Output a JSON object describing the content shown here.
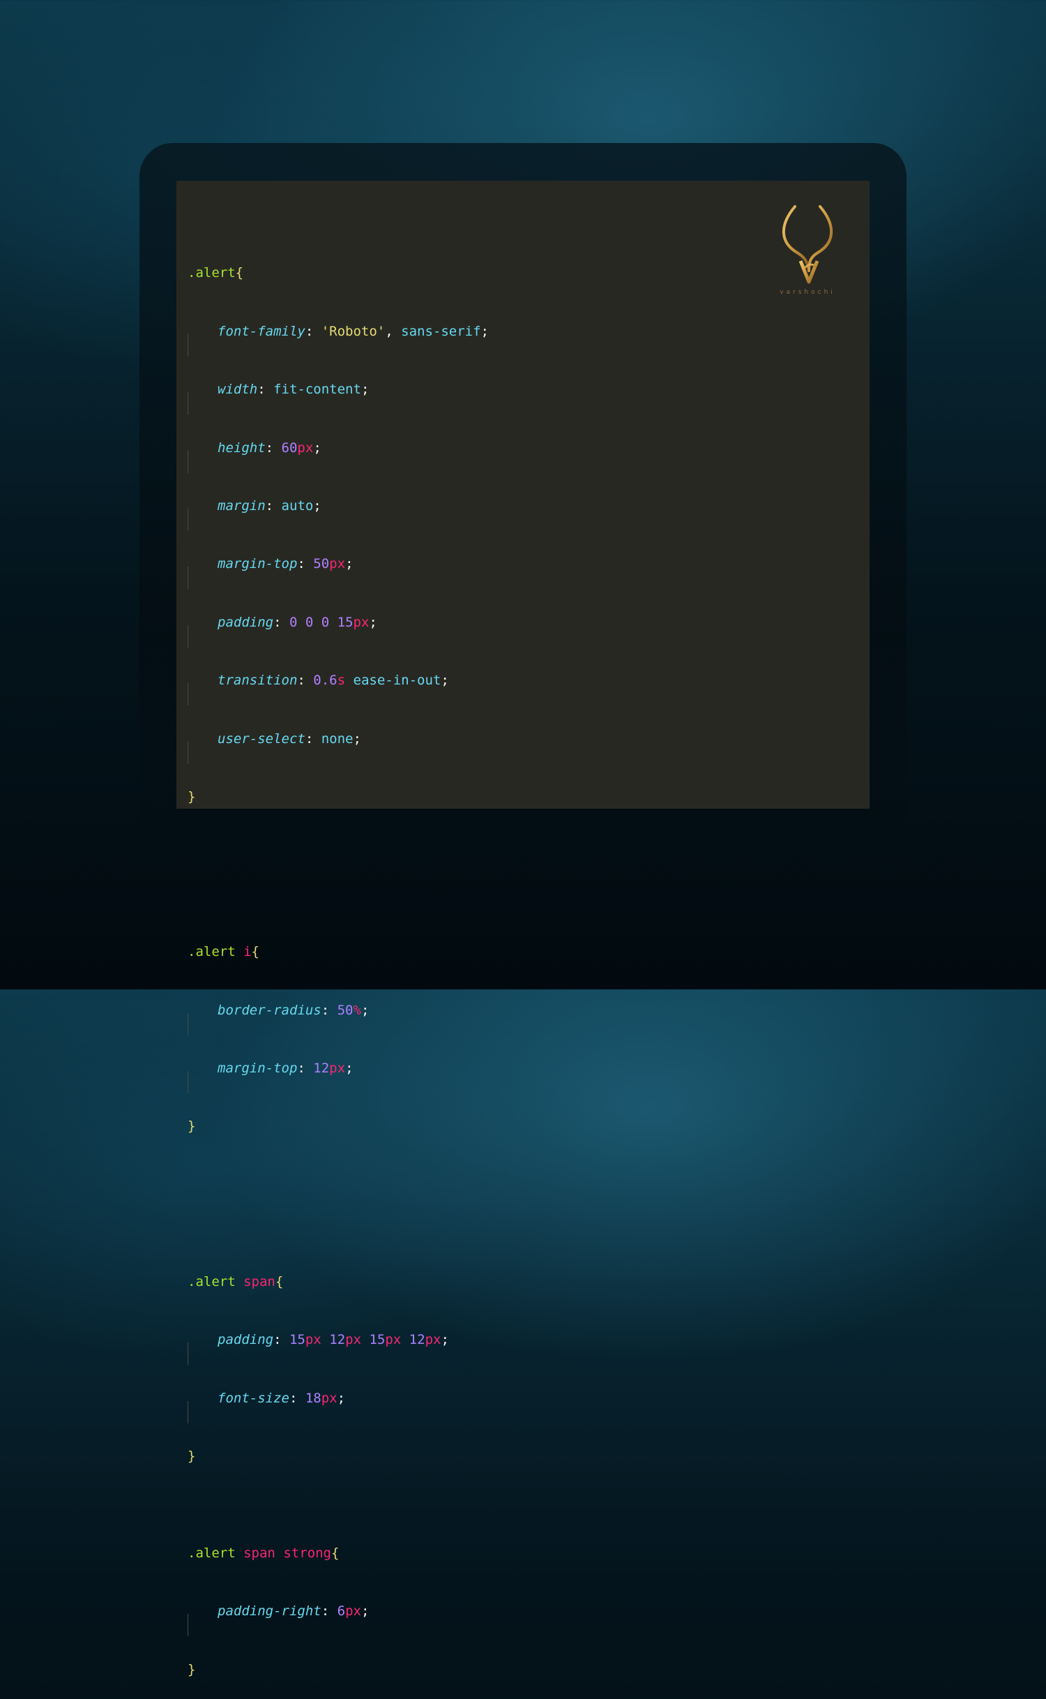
{
  "colors": {
    "editor_bg": "#282823",
    "selector": "#a6e22e",
    "tag": "#f92672",
    "brace": "#e6db74",
    "property": "#66d9ef",
    "string": "#e6db74",
    "number": "#ae81ff",
    "unit": "#f92672",
    "logo_gold": "#c8973f"
  },
  "logo": {
    "icon": "antler-v-logo-icon",
    "text": "varshochi"
  },
  "code": {
    "rule1": {
      "selector": ".alert",
      "open": "{",
      "close": "}",
      "decl": [
        {
          "prop": "font-family",
          "str": "'Roboto'",
          "val": "sans-serif"
        },
        {
          "prop": "width",
          "val": "fit-content"
        },
        {
          "prop": "height",
          "num": "60",
          "unit": "px"
        },
        {
          "prop": "margin",
          "val": "auto"
        },
        {
          "prop": "margin-top",
          "num": "50",
          "unit": "px"
        },
        {
          "prop": "padding",
          "nums": "0 0 0 15",
          "unit": "px"
        },
        {
          "prop": "transition",
          "num": "0.6",
          "unit": "s",
          "val": "ease-in-out"
        },
        {
          "prop": "user-select",
          "val": "none"
        }
      ]
    },
    "rule2": {
      "selector": ".alert",
      "tag": "i",
      "open": "{",
      "close": "}",
      "decl": [
        {
          "prop": "border-radius",
          "num": "50",
          "unit": "%"
        },
        {
          "prop": "margin-top",
          "num": "12",
          "unit": "px"
        }
      ]
    },
    "rule3": {
      "selector": ".alert",
      "tag": "span",
      "open": "{",
      "close": "}",
      "decl": [
        {
          "prop": "padding",
          "n1": "15",
          "n2": "12",
          "n3": "15",
          "n4": "12",
          "unit": "px"
        },
        {
          "prop": "font-size",
          "num": "18",
          "unit": "px"
        }
      ]
    },
    "rule4": {
      "selector": ".alert",
      "tag1": "span",
      "tag2": "strong",
      "open": "{",
      "close": "}",
      "decl": [
        {
          "prop": "padding-right",
          "num": "6",
          "unit": "px"
        }
      ]
    }
  }
}
